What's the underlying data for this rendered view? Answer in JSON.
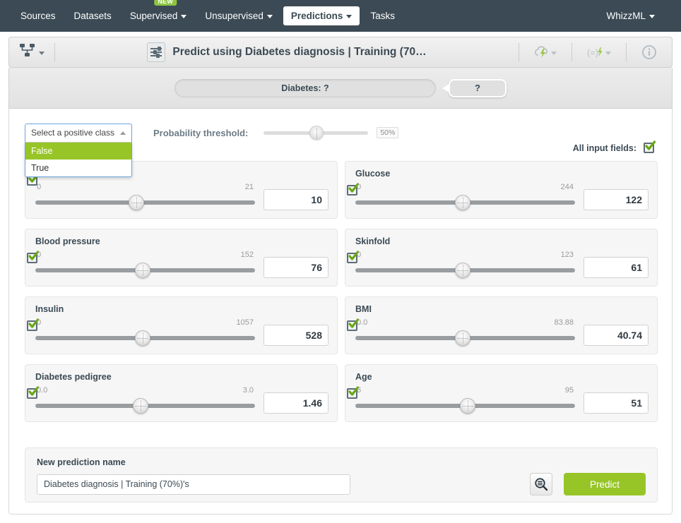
{
  "navbar": {
    "items": [
      {
        "label": "Sources",
        "caret": false,
        "active": false,
        "badge": null
      },
      {
        "label": "Datasets",
        "caret": false,
        "active": false,
        "badge": null
      },
      {
        "label": "Supervised",
        "caret": true,
        "active": false,
        "badge": "NEW"
      },
      {
        "label": "Unsupervised",
        "caret": true,
        "active": false,
        "badge": null
      },
      {
        "label": "Predictions",
        "caret": true,
        "active": true,
        "badge": null
      },
      {
        "label": "Tasks",
        "caret": false,
        "active": false,
        "badge": null
      }
    ],
    "right_label": "WhizzML"
  },
  "titlebar": {
    "title": "Predict using Diabetes diagnosis | Training (70…",
    "left_icon": "model-tree-icon",
    "center_icon": "sliders-icon",
    "right_icons": [
      "lightning-cloud-icon",
      "batch-prediction-icon",
      "info-icon"
    ]
  },
  "objective": {
    "bar_label": "Diabetes: ?",
    "bubble_label": "?"
  },
  "controls": {
    "positive_class_select": {
      "value": "Select a positive class",
      "expanded": true,
      "options": [
        {
          "label": "False",
          "selected": true
        },
        {
          "label": "True",
          "selected": false
        }
      ]
    },
    "probability_threshold": {
      "label": "Probability threshold:",
      "value_label": "50%",
      "percent": 44
    },
    "all_input_fields": {
      "label": "All input fields:",
      "checked": true
    }
  },
  "fields": [
    {
      "name": "",
      "min": "0",
      "max": "21",
      "value": "10",
      "percent": 46,
      "checked": true
    },
    {
      "name": "Glucose",
      "min": "0",
      "max": "244",
      "value": "122",
      "percent": 49,
      "checked": true
    },
    {
      "name": "Blood pressure",
      "min": "0",
      "max": "152",
      "value": "76",
      "percent": 49,
      "checked": true
    },
    {
      "name": "Skinfold",
      "min": "0",
      "max": "123",
      "value": "61",
      "percent": 49,
      "checked": true
    },
    {
      "name": "Insulin",
      "min": "0",
      "max": "1057",
      "value": "528",
      "percent": 49,
      "checked": true
    },
    {
      "name": "BMI",
      "min": "0.0",
      "max": "83.88",
      "value": "40.74",
      "percent": 49,
      "checked": true
    },
    {
      "name": "Diabetes pedigree",
      "min": "0.0",
      "max": "3.0",
      "value": "1.46",
      "percent": 48,
      "checked": true
    },
    {
      "name": "Age",
      "min": "6",
      "max": "95",
      "value": "51",
      "percent": 51,
      "checked": true
    }
  ],
  "bottom": {
    "label": "New prediction name",
    "input_value": "Diabetes diagnosis | Training (70%)'s",
    "input_placeholder": "New prediction name",
    "inspect_icon": "search-list-icon",
    "predict_label": "Predict"
  },
  "colors": {
    "navbar": "#3b4a54",
    "accent_green": "#97c527",
    "text_dark": "#3b4a54"
  }
}
